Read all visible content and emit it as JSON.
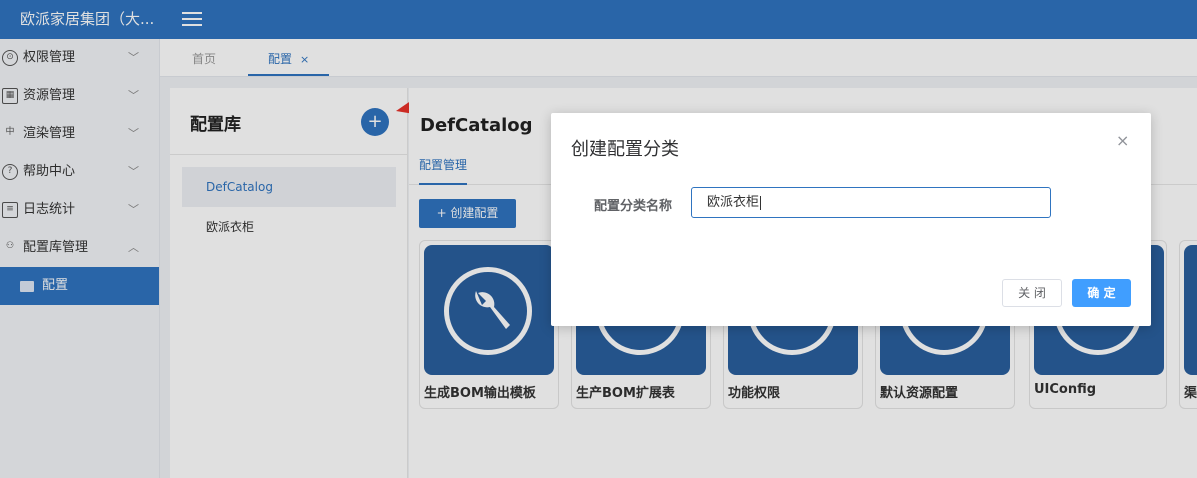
{
  "topbar": {
    "brand": "欧派家居集团（大...",
    "menu_icon": "menu-fold-icon",
    "color": "#2f74c0"
  },
  "sidebar": {
    "items": [
      {
        "label": "权限管理",
        "icon": "shield-icon",
        "expanded": false
      },
      {
        "label": "资源管理",
        "icon": "resource-icon",
        "expanded": false
      },
      {
        "label": "渲染管理",
        "icon": "render-icon",
        "expanded": false
      },
      {
        "label": "帮助中心",
        "icon": "help-icon",
        "expanded": false
      },
      {
        "label": "日志统计",
        "icon": "log-icon",
        "expanded": false
      },
      {
        "label": "配置库管理",
        "icon": "org-icon",
        "expanded": true
      }
    ],
    "sub_item": {
      "label": "配置",
      "icon": "folder-icon"
    }
  },
  "tabs": [
    {
      "label": "首页",
      "active": false
    },
    {
      "label": "配置",
      "active": true,
      "close": "×"
    }
  ],
  "left_panel": {
    "title": "配置库",
    "add_symbol": "+",
    "items": [
      {
        "label": "DefCatalog",
        "active": true
      },
      {
        "label": "欧派衣柜",
        "active": false
      }
    ]
  },
  "main": {
    "title": "DefCatalog",
    "tab": "配置管理",
    "create_button": "+ 创建配置",
    "cards": [
      {
        "label": "生成BOM输出模板",
        "icon": "wrench-icon"
      },
      {
        "label": "生产BOM扩展表",
        "icon": "wrench-icon"
      },
      {
        "label": "功能权限",
        "icon": "wrench-icon"
      },
      {
        "label": "默认资源配置",
        "icon": "wrench-icon"
      },
      {
        "label": "UIConfig",
        "icon": "wrench-icon"
      },
      {
        "label": "渠",
        "icon": "wrench-icon"
      }
    ]
  },
  "dialog": {
    "title": "创建配置分类",
    "close_symbol": "×",
    "field_label": "配置分类名称",
    "field_value": "欧派衣柜",
    "cancel_label": "关 闭",
    "ok_label": "确 定"
  }
}
